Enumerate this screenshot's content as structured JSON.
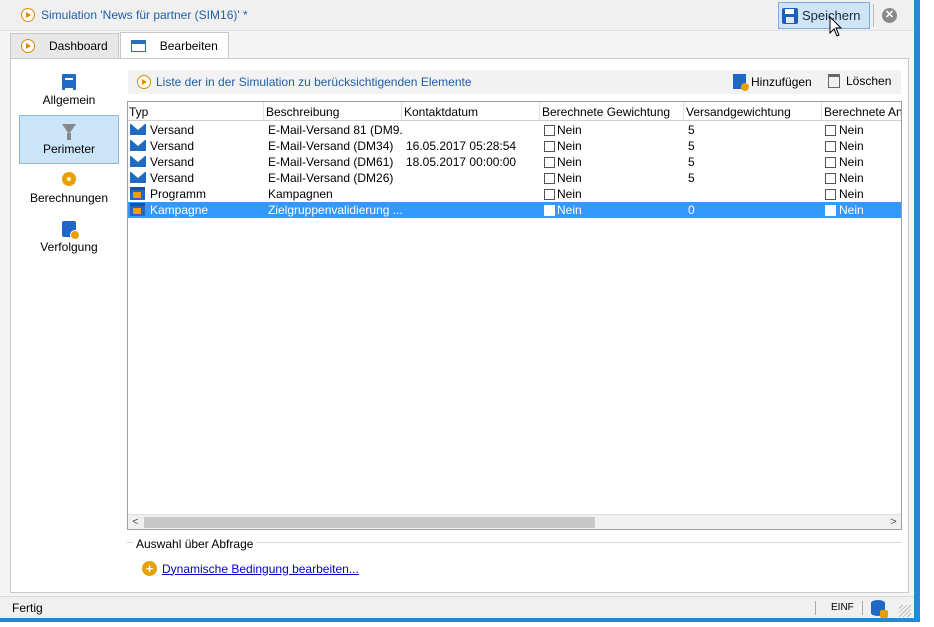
{
  "window": {
    "title": "Simulation 'News für partner (SIM16)' *",
    "save_label": "Speichern",
    "close_glyph": "✕"
  },
  "tabs": [
    {
      "label": "Dashboard",
      "icon": "play-circle-icon",
      "active": false
    },
    {
      "label": "Bearbeiten",
      "icon": "edit-window-icon",
      "active": true
    }
  ],
  "sidebar": {
    "items": [
      {
        "label": "Allgemein",
        "icon": "clipboard-icon",
        "active": false
      },
      {
        "label": "Perimeter",
        "icon": "funnel-icon",
        "active": true
      },
      {
        "label": "Berechnungen",
        "icon": "gear-icon",
        "active": false
      },
      {
        "label": "Verfolgung",
        "icon": "tracking-icon",
        "active": false
      }
    ]
  },
  "panel": {
    "title": "Liste der in der Simulation zu berücksichtigenden Elemente",
    "add_label": "Hinzufügen",
    "delete_label": "Löschen"
  },
  "table": {
    "columns": [
      "Typ",
      "Beschreibung",
      "Kontaktdatum",
      "Berechnete Gewichtung",
      "Versandgewichtung",
      "Berechnete An"
    ],
    "rows": [
      {
        "type": "Versand",
        "icon": "mail-icon",
        "desc": "E-Mail-Versand 81 (DM9...",
        "date": "",
        "calc_weight": "Nein",
        "send_weight": "5",
        "calc_other": "Nein",
        "selected": false
      },
      {
        "type": "Versand",
        "icon": "mail-icon",
        "desc": "E-Mail-Versand (DM34)",
        "date": "16.05.2017 05:28:54",
        "calc_weight": "Nein",
        "send_weight": "5",
        "calc_other": "Nein",
        "selected": false
      },
      {
        "type": "Versand",
        "icon": "mail-icon",
        "desc": "E-Mail-Versand (DM61)",
        "date": "18.05.2017 00:00:00",
        "calc_weight": "Nein",
        "send_weight": "5",
        "calc_other": "Nein",
        "selected": false
      },
      {
        "type": "Versand",
        "icon": "mail-icon",
        "desc": "E-Mail-Versand (DM26)",
        "date": "",
        "calc_weight": "Nein",
        "send_weight": "5",
        "calc_other": "Nein",
        "selected": false
      },
      {
        "type": "Programm",
        "icon": "program-icon",
        "desc": "Kampagnen",
        "date": "",
        "calc_weight": "Nein",
        "send_weight": "",
        "calc_other": "Nein",
        "selected": false
      },
      {
        "type": "Kampagne",
        "icon": "campaign-icon",
        "desc": "Zielgruppenvalidierung ...",
        "date": "",
        "calc_weight": "Nein",
        "send_weight": "0",
        "calc_other": "Nein",
        "selected": true
      }
    ]
  },
  "query_section": {
    "legend": "Auswahl über Abfrage",
    "link": "Dynamische Bedingung bearbeiten..."
  },
  "status": {
    "text": "Fertig",
    "mode": "EINF"
  }
}
